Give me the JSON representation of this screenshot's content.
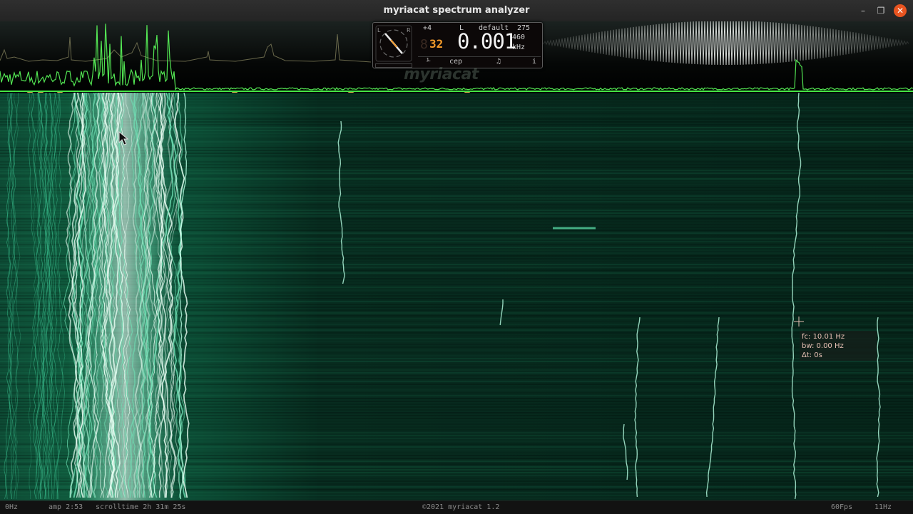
{
  "window": {
    "title": "myriacat spectrum analyzer",
    "minimize": "–",
    "maximize": "❐",
    "close": "✕"
  },
  "panel": {
    "pitch_offset": "+4",
    "channel": "L",
    "preset": "default",
    "num_top": "275",
    "octave": "32",
    "frequency": "0.001",
    "num_mid": "460",
    "unit": "kHz",
    "toolbar": {
      "b1": "⅟",
      "b2": "cep",
      "b3": "♫",
      "info": "i"
    },
    "dial_labels": [
      "L",
      "R"
    ]
  },
  "logo": "myriacat",
  "tooltip": {
    "fc": "fc: 10.01 Hz",
    "bw": "bw: 0.00 Hz",
    "dt": "Δt: 0s"
  },
  "status": {
    "left_freq": "0Hz",
    "amp": "amp 2:53",
    "scrolltime": "scrolltime 2h 31m 25s",
    "copyright": "©2021 myriacat 1.2",
    "fps": "60Fps",
    "right_freq": "11Hz"
  },
  "colors": {
    "accent_green": "#4dff4d",
    "waterfall_green": "#1fa868",
    "marker": "#d8b84a",
    "close_button": "#e95420"
  },
  "icons": {
    "dial": "tuner-dial-icon",
    "cursor": "mouse-pointer-icon",
    "crosshair": "crosshair-icon"
  }
}
